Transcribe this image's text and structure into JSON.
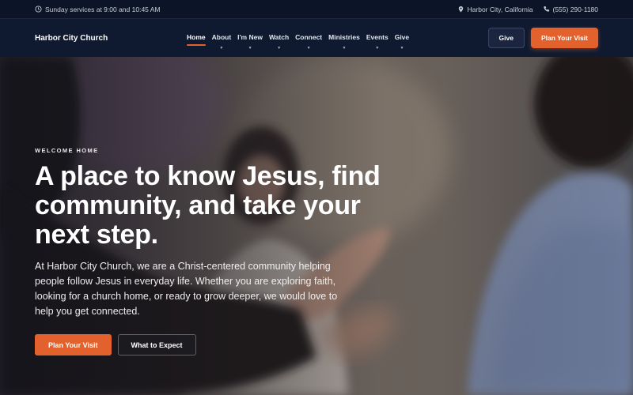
{
  "topbar": {
    "service_times": "Sunday services at 9:00 and 10:45 AM",
    "location": "Harbor City, California",
    "phone": "(555) 290-1180",
    "icons": {
      "clock": "clock-icon",
      "pin": "map-pin-icon",
      "phone": "phone-icon"
    }
  },
  "nav": {
    "brand": "Harbor City Church",
    "items": [
      {
        "label": "Home",
        "active": true,
        "dropdown": false
      },
      {
        "label": "About",
        "active": false,
        "dropdown": true
      },
      {
        "label": "I'm New",
        "active": false,
        "dropdown": true
      },
      {
        "label": "Watch",
        "active": false,
        "dropdown": true
      },
      {
        "label": "Connect",
        "active": false,
        "dropdown": true
      },
      {
        "label": "Ministries",
        "active": false,
        "dropdown": true
      },
      {
        "label": "Events",
        "active": false,
        "dropdown": true
      },
      {
        "label": "Give",
        "active": false,
        "dropdown": true
      }
    ],
    "give_button": "Give",
    "plan_button": "Plan Your Visit"
  },
  "hero": {
    "eyebrow": "WELCOME HOME",
    "headline": "A place to know Jesus, find community, and take your next step.",
    "body": "At Harbor City Church, we are a Christ-centered community helping people follow Jesus in everyday life. Whether you are exploring faith, looking for a church home, or ready to grow deeper, we would love to help you get connected.",
    "primary_button": "Plan Your Visit",
    "secondary_button": "What to Expect"
  },
  "colors": {
    "accent": "#e3612c",
    "nav_bg": "#0f1a30",
    "topbar_bg": "#0c1528"
  }
}
